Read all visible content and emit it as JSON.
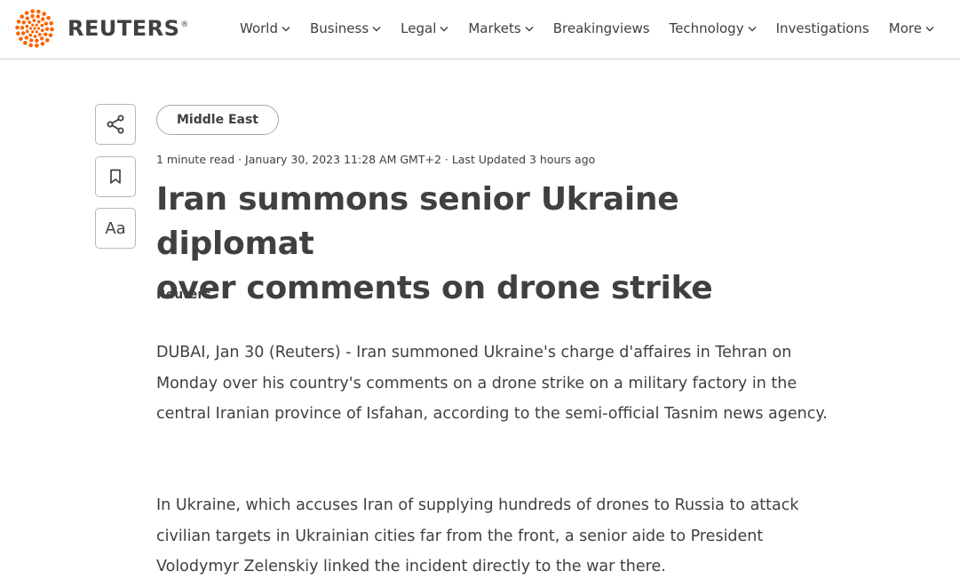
{
  "brand": {
    "name": "REUTERS",
    "registered": "®"
  },
  "nav": {
    "items": [
      {
        "label": "World",
        "has_dropdown": true
      },
      {
        "label": "Business",
        "has_dropdown": true
      },
      {
        "label": "Legal",
        "has_dropdown": true
      },
      {
        "label": "Markets",
        "has_dropdown": true
      },
      {
        "label": "Breakingviews",
        "has_dropdown": false
      },
      {
        "label": "Technology",
        "has_dropdown": true
      },
      {
        "label": "Investigations",
        "has_dropdown": false
      },
      {
        "label": "More",
        "has_dropdown": true
      }
    ]
  },
  "tools": {
    "share_icon": "share-icon",
    "bookmark_icon": "bookmark-icon",
    "text_size_label": "Aa"
  },
  "article": {
    "section_tag": "Middle East",
    "meta": "1 minute read · January 30, 2023 11:28 AM GMT+2 · Last Updated 3 hours ago",
    "headline_line1": "Iran summons senior Ukraine diplomat",
    "headline_line2": "over comments on drone strike",
    "byline": "Reuters",
    "paragraphs": [
      "DUBAI, Jan 30 (Reuters) - Iran summoned Ukraine's charge d'affaires in Tehran on Monday over his country's comments on a drone strike on a military factory in the central Iranian province of Isfahan, according to the semi-official Tasnim news agency.",
      "In Ukraine, which accuses Iran of supplying hundreds of drones to Russia to attack civilian targets in Ukrainian cities far from the front, a senior aide to President Volodymyr Zelenskiy linked the incident directly to the war there."
    ]
  },
  "colors": {
    "text": "#404040",
    "brand_orange": "#fa6400",
    "border": "#d0d0d0"
  }
}
